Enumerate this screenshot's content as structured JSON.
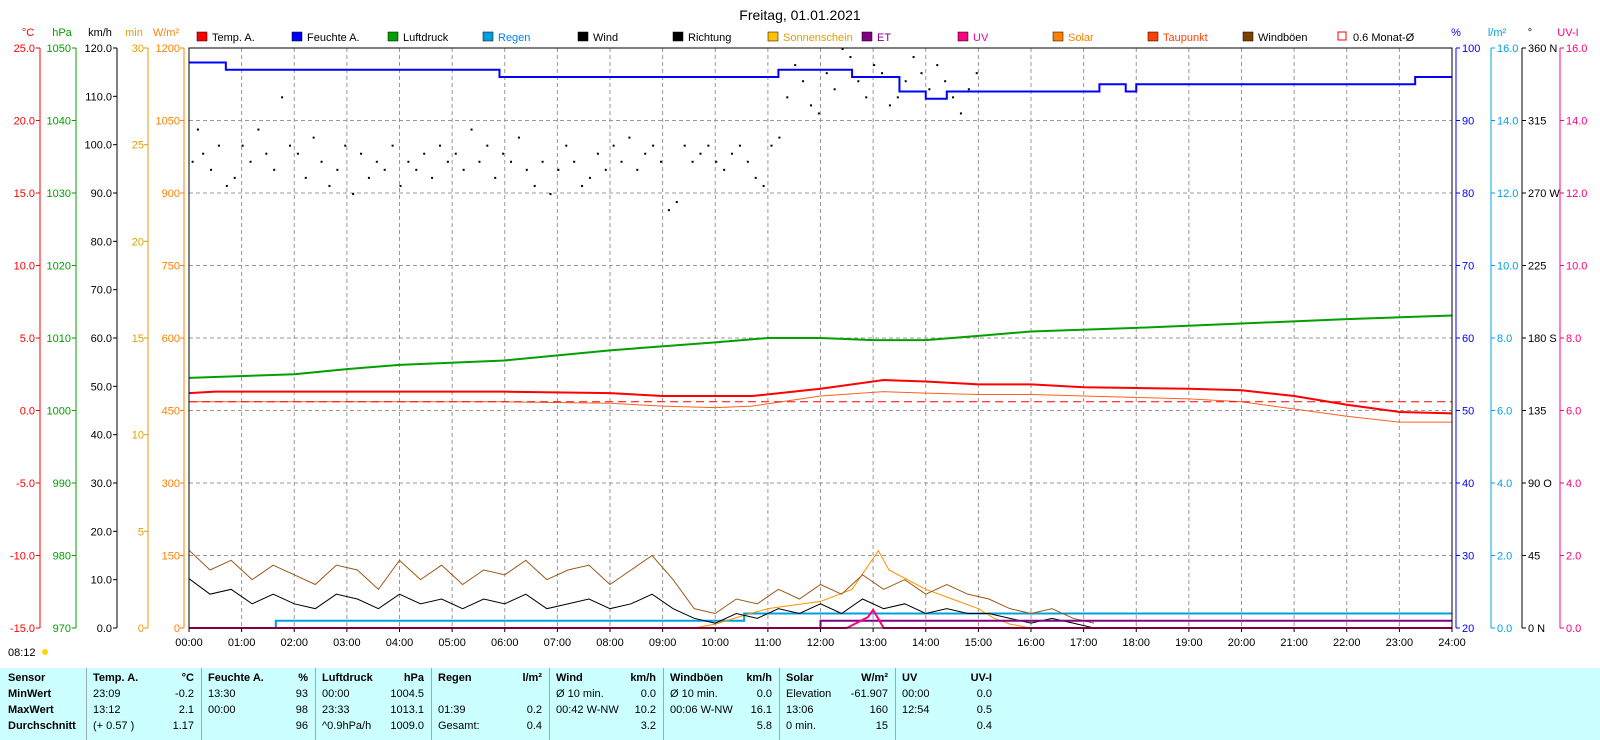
{
  "title": "Freitag, 01.01.2021",
  "axes": {
    "temp": {
      "unit": "°C",
      "ticks": [
        "25.0",
        "20.0",
        "15.0",
        "10.0",
        "5.0",
        "0.0",
        "-5.0",
        "-10.0",
        "-15.0"
      ],
      "color": "#ff0000"
    },
    "press": {
      "unit": "hPa",
      "ticks": [
        "1050",
        "1040",
        "1030",
        "1020",
        "1010",
        "1000",
        "990",
        "980",
        "970"
      ],
      "color": "#00a000"
    },
    "wind": {
      "unit": "km/h",
      "ticks": [
        "120.0",
        "110.0",
        "100.0",
        "90.0",
        "80.0",
        "70.0",
        "60.0",
        "50.0",
        "40.0",
        "30.0",
        "20.0",
        "10.0",
        "0.0"
      ],
      "color": "#000000"
    },
    "min": {
      "unit": "min",
      "ticks": [
        "30",
        "25",
        "20",
        "15",
        "10",
        "5",
        "0"
      ],
      "color": "#e0a000"
    },
    "solar": {
      "unit": "W/m²",
      "ticks": [
        "1200",
        "1050",
        "900",
        "750",
        "600",
        "450",
        "300",
        "150",
        "0"
      ],
      "color": "#ff8000"
    },
    "hum": {
      "unit": "%",
      "ticks": [
        "100",
        "90",
        "80",
        "70",
        "60",
        "50",
        "40",
        "30",
        "20"
      ],
      "color": "#0000ff"
    },
    "rain": {
      "unit": "l/m²",
      "ticks": [
        "16.0",
        "14.0",
        "12.0",
        "10.0",
        "8.0",
        "6.0",
        "4.0",
        "2.0",
        "0.0"
      ],
      "color": "#00a0e0"
    },
    "dir": {
      "unit": "°",
      "ticks": [
        "360 N",
        "315",
        "270 W",
        "225",
        "180 S",
        "135",
        "90 O",
        "45",
        "0 N"
      ],
      "color": "#000000"
    },
    "uv": {
      "unit": "UV-I",
      "ticks": [
        "16.0",
        "14.0",
        "12.0",
        "10.0",
        "8.0",
        "6.0",
        "4.0",
        "2.0",
        "0.0"
      ],
      "color": "#ff0080"
    }
  },
  "x_ticks": [
    "00:00",
    "01:00",
    "02:00",
    "03:00",
    "04:00",
    "05:00",
    "06:00",
    "07:00",
    "08:00",
    "09:00",
    "10:00",
    "11:00",
    "12:00",
    "13:00",
    "14:00",
    "15:00",
    "16:00",
    "17:00",
    "18:00",
    "19:00",
    "20:00",
    "21:00",
    "22:00",
    "23:00",
    "24:00"
  ],
  "sunrise": "08:12",
  "legend": [
    {
      "label": "Temp. A.",
      "color": "#ff0000",
      "type": "fill"
    },
    {
      "label": "Feuchte A.",
      "color": "#0000ff",
      "type": "fill"
    },
    {
      "label": "Luftdruck",
      "color": "#00a000",
      "type": "fill"
    },
    {
      "label": "Regen",
      "color": "#00a0e0",
      "type": "fill"
    },
    {
      "label": "Wind",
      "color": "#000000",
      "type": "fill"
    },
    {
      "label": "Richtung",
      "color": "#000000",
      "type": "fill"
    },
    {
      "label": "Sonnenschein",
      "color": "#ffc000",
      "type": "fill"
    },
    {
      "label": "ET",
      "color": "#800080",
      "type": "fill"
    },
    {
      "label": "UV",
      "color": "#ff0080",
      "type": "fill"
    },
    {
      "label": "Solar",
      "color": "#ff8000",
      "type": "fill"
    },
    {
      "label": "Taupunkt",
      "color": "#ff4000",
      "type": "fill"
    },
    {
      "label": "Windböen",
      "color": "#804000",
      "type": "fill"
    },
    {
      "label": "0.6 Monat-Ø",
      "color": "#ff0000",
      "type": "outline"
    }
  ],
  "chart_data": {
    "type": "line",
    "x_unit": "hour",
    "series": [
      {
        "name": "Temp. A.",
        "color": "#ff0000",
        "axis": "temp",
        "x": [
          0,
          0.5,
          2,
          4,
          6,
          8,
          9,
          10.7,
          12,
          13.2,
          14,
          15,
          16,
          17,
          19,
          20,
          21,
          22,
          23,
          24
        ],
        "y": [
          1.2,
          1.3,
          1.3,
          1.3,
          1.3,
          1.2,
          1.0,
          1.0,
          1.5,
          2.1,
          2.0,
          1.8,
          1.8,
          1.6,
          1.5,
          1.4,
          1.0,
          0.4,
          -0.1,
          -0.2
        ]
      },
      {
        "name": "Taupunkt",
        "color": "#ff6020",
        "axis": "temp",
        "x": [
          0,
          2,
          4,
          6,
          8,
          9,
          10,
          10.7,
          12,
          13.2,
          14,
          15,
          16,
          17,
          19,
          20,
          21,
          22,
          23,
          24
        ],
        "y": [
          0.6,
          0.6,
          0.6,
          0.6,
          0.5,
          0.3,
          0.2,
          0.3,
          1.0,
          1.3,
          1.2,
          1.1,
          1.1,
          1.0,
          0.8,
          0.6,
          0.1,
          -0.4,
          -0.8,
          -0.8
        ]
      },
      {
        "name": "0.6 Monat-Ø",
        "color": "#ff0000",
        "axis": "temp",
        "dashed": true,
        "x": [
          0,
          24
        ],
        "y": [
          0.6,
          0.6
        ]
      },
      {
        "name": "Feuchte A.",
        "color": "#0000ff",
        "axis": "hum",
        "step": true,
        "x": [
          0,
          0.7,
          5.9,
          10.8,
          11.2,
          12.6,
          13.5,
          14.0,
          14.4,
          15,
          16,
          17,
          17.3,
          17.8,
          18,
          23,
          23.3,
          24
        ],
        "y": [
          98,
          97,
          96,
          96,
          97,
          96,
          94,
          93,
          94,
          94,
          94,
          94,
          95,
          94,
          95,
          95,
          96,
          96
        ]
      },
      {
        "name": "Luftdruck",
        "color": "#00a000",
        "axis": "press",
        "x": [
          0,
          2,
          3,
          4,
          6,
          8,
          10,
          11,
          12,
          13,
          14,
          15,
          16,
          18,
          20,
          22,
          24
        ],
        "y": [
          1004.5,
          1005.0,
          1005.7,
          1006.3,
          1006.9,
          1008.3,
          1009.4,
          1010.0,
          1010.0,
          1009.7,
          1009.7,
          1010.3,
          1010.9,
          1011.4,
          1012.0,
          1012.6,
          1013.1
        ]
      },
      {
        "name": "Regen",
        "color": "#00a0e0",
        "axis": "rain",
        "step": true,
        "x": [
          0,
          1.65,
          10.55,
          24
        ],
        "y": [
          0.0,
          0.2,
          0.4,
          0.4
        ]
      },
      {
        "name": "Solar",
        "color": "#ff9000",
        "axis": "solar",
        "x": [
          0,
          9.6,
          10.0,
          10.6,
          11,
          12,
          12.6,
          13.1,
          13.3,
          14,
          14.5,
          15,
          15.3,
          15.6,
          16,
          24
        ],
        "y": [
          0,
          0,
          8,
          28,
          40,
          55,
          80,
          160,
          120,
          80,
          60,
          40,
          20,
          8,
          0,
          0
        ]
      },
      {
        "name": "Windböen",
        "color": "#9a5a1a",
        "axis": "wind",
        "x": [
          0,
          0.4,
          0.8,
          1.2,
          1.6,
          2,
          2.4,
          2.8,
          3.2,
          3.6,
          4,
          4.4,
          4.8,
          5.2,
          5.6,
          6,
          6.4,
          6.8,
          7.2,
          7.6,
          8,
          8.4,
          8.8,
          9.2,
          9.6,
          10,
          10.4,
          10.8,
          11.2,
          11.6,
          12,
          12.4,
          12.8,
          13.2,
          13.6,
          14,
          14.4,
          14.8,
          15.2,
          15.6,
          16,
          16.4,
          16.8,
          17.2
        ],
        "y": [
          16.1,
          12,
          14,
          10,
          13,
          11,
          9,
          13,
          12,
          8,
          14,
          10,
          13,
          9,
          12,
          11,
          14,
          10,
          12,
          13,
          9,
          12,
          15,
          10,
          4,
          3,
          6,
          5,
          8,
          6,
          9,
          7,
          11,
          8,
          10,
          7,
          9,
          7,
          6,
          4,
          3,
          4,
          2,
          1
        ]
      },
      {
        "name": "Wind",
        "color": "#000000",
        "axis": "wind",
        "x": [
          0,
          0.4,
          0.8,
          1.2,
          1.6,
          2,
          2.4,
          2.8,
          3.2,
          3.6,
          4,
          4.4,
          4.8,
          5.2,
          5.6,
          6,
          6.4,
          6.8,
          7.2,
          7.6,
          8,
          8.4,
          8.8,
          9.2,
          9.6,
          10,
          10.4,
          10.8,
          11.2,
          11.6,
          12,
          12.4,
          12.8,
          13.2,
          13.6,
          14,
          14.4,
          14.8,
          15.2,
          15.6,
          16,
          16.4,
          16.8,
          17.2
        ],
        "y": [
          10.2,
          7,
          8,
          5,
          7,
          5,
          4,
          7,
          6,
          4,
          7,
          5,
          6,
          4,
          6,
          5,
          7,
          4,
          5,
          6,
          4,
          5,
          7,
          4,
          2,
          1,
          3,
          2,
          4,
          3,
          5,
          3,
          6,
          4,
          5,
          3,
          4,
          3,
          3,
          2,
          1,
          2,
          1,
          0
        ]
      },
      {
        "name": "ET",
        "color": "#800080",
        "axis": "uv",
        "step": true,
        "x": [
          0,
          12.0,
          24
        ],
        "y": [
          0.0,
          0.2,
          0.2
        ]
      },
      {
        "name": "UV",
        "color": "#ff0080",
        "axis": "uv",
        "x": [
          0,
          12.5,
          12.9,
          13.0,
          13.2,
          24
        ],
        "y": [
          0,
          0,
          0.3,
          0.5,
          0,
          0
        ]
      }
    ],
    "direction": {
      "name": "Richtung",
      "color": "#000000",
      "axis": "dir",
      "x": [
        0.05,
        0.15,
        0.25,
        0.4,
        0.55,
        0.7,
        0.85,
        1.0,
        1.15,
        1.3,
        1.45,
        1.6,
        1.75,
        1.9,
        2.05,
        2.2,
        2.35,
        2.5,
        2.65,
        2.8,
        2.95,
        3.1,
        3.25,
        3.4,
        3.55,
        3.7,
        3.85,
        4.0,
        4.15,
        4.3,
        4.45,
        4.6,
        4.75,
        4.9,
        5.05,
        5.2,
        5.35,
        5.5,
        5.65,
        5.8,
        5.95,
        6.1,
        6.25,
        6.4,
        6.55,
        6.7,
        6.85,
        7.0,
        7.15,
        7.3,
        7.45,
        7.6,
        7.75,
        7.9,
        8.05,
        8.2,
        8.35,
        8.5,
        8.65,
        8.8,
        8.95,
        9.1,
        9.25,
        9.4,
        9.55,
        9.7,
        9.85,
        10.0,
        10.15,
        10.3,
        10.45,
        10.6,
        10.75,
        10.9,
        11.05,
        11.2,
        11.35,
        11.5,
        11.65,
        11.8,
        11.95,
        12.1,
        12.25,
        12.4,
        12.55,
        12.7,
        12.85,
        13.0,
        13.15,
        13.3,
        13.45,
        13.6,
        13.75,
        13.9,
        14.05,
        14.2,
        14.35,
        14.5,
        14.65,
        14.8,
        14.95
      ],
      "y": [
        290,
        310,
        295,
        285,
        300,
        275,
        280,
        300,
        290,
        310,
        295,
        285,
        330,
        300,
        295,
        280,
        305,
        290,
        275,
        285,
        300,
        270,
        295,
        280,
        290,
        285,
        300,
        275,
        290,
        285,
        295,
        280,
        300,
        290,
        295,
        285,
        310,
        290,
        300,
        280,
        295,
        290,
        305,
        285,
        275,
        290,
        270,
        285,
        300,
        290,
        275,
        280,
        295,
        285,
        300,
        290,
        305,
        285,
        295,
        300,
        290,
        260,
        265,
        300,
        290,
        295,
        300,
        290,
        285,
        295,
        300,
        290,
        280,
        275,
        300,
        305,
        330,
        350,
        340,
        325,
        320,
        345,
        335,
        360,
        355,
        340,
        330,
        350,
        345,
        325,
        330,
        340,
        355,
        345,
        335,
        350,
        340,
        330,
        320,
        335,
        345
      ]
    }
  },
  "table": {
    "sections": [
      {
        "header": "Sensor",
        "min": "MinWert",
        "max": "MaxWert",
        "avg": "Durchschnitt"
      },
      {
        "header": "Temp. A.",
        "unit": "°C",
        "min_time": "23:09",
        "min_val": "-0.2",
        "max_time": "13:12",
        "max_val": "2.1",
        "avg_extra": "(+ 0.57 )",
        "avg_val": "1.17"
      },
      {
        "header": "Feuchte A.",
        "unit": "%",
        "min_time": "13:30",
        "min_val": "93",
        "max_time": "00:00",
        "max_val": "98",
        "avg_extra": "",
        "avg_val": "96"
      },
      {
        "header": "Luftdruck",
        "unit": "hPa",
        "min_time": "00:00",
        "min_val": "1004.5",
        "max_time": "23:33",
        "max_val": "1013.1",
        "avg_extra": "^0.9hPa/h",
        "avg_val": "1009.0"
      },
      {
        "header": "Regen",
        "unit": "l/m²",
        "min_time": "",
        "min_val": "",
        "max_time": "01:39",
        "max_val": "0.2",
        "avg_extra": "Gesamt:",
        "avg_val": "0.4"
      },
      {
        "header": "Wind",
        "unit": "km/h",
        "min_time": "Ø 10 min.",
        "min_val": "0.0",
        "max_time": "00:42   W-NW",
        "max_val": "10.2",
        "avg_extra": "",
        "avg_val": "3.2"
      },
      {
        "header": "Windböen",
        "unit": "km/h",
        "min_time": "Ø 10 min.",
        "min_val": "0.0",
        "max_time": "00:06   W-NW",
        "max_val": "16.1",
        "avg_extra": "",
        "avg_val": "5.8"
      },
      {
        "header": "Solar",
        "unit": "W/m²",
        "min_time": "Elevation",
        "min_val": "-61.907",
        "max_time": "13:06",
        "max_val": "160",
        "avg_extra": "0 min.",
        "avg_val": "15"
      },
      {
        "header": "UV",
        "unit": "UV-I",
        "min_time": "00:00",
        "min_val": "0.0",
        "max_time": "12:54",
        "max_val": "0.5",
        "avg_extra": "",
        "avg_val": "0.4"
      }
    ]
  }
}
